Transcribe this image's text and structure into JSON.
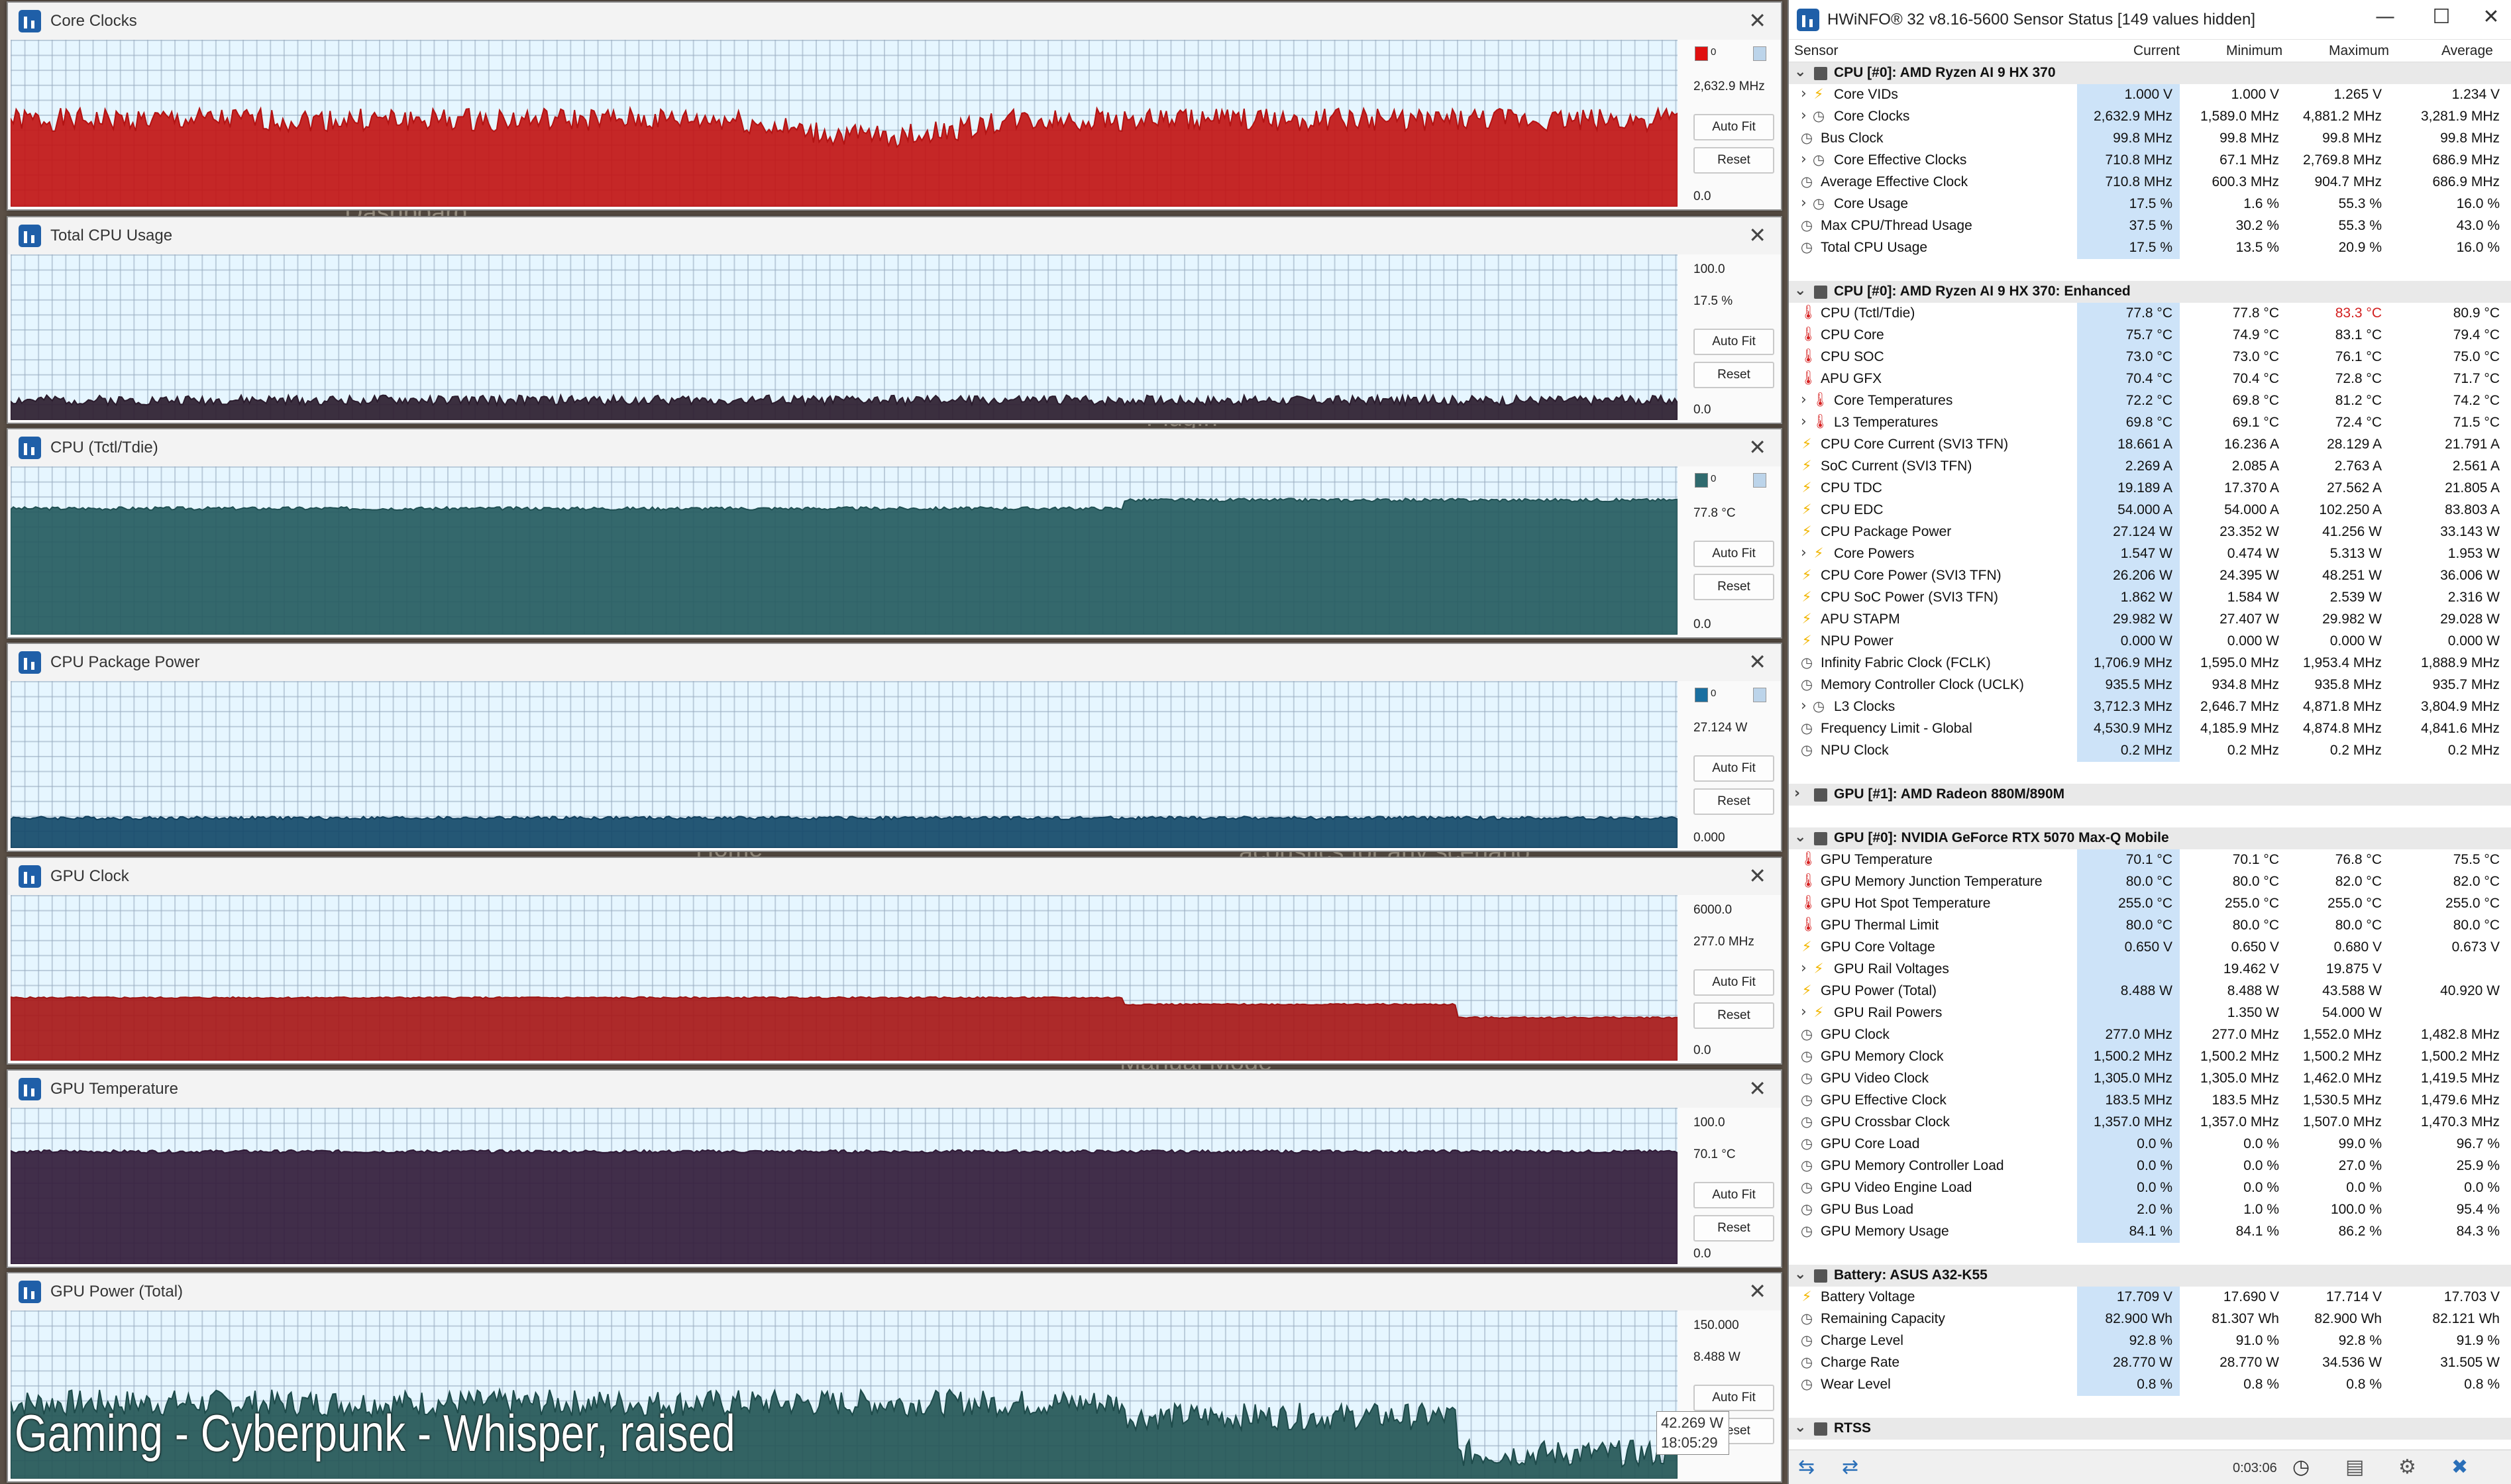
{
  "background": {
    "texts": [
      "Dashboard",
      "PlugIn",
      "Color Control",
      "Home",
      "acoustics for any scenario",
      "Manual Mode"
    ]
  },
  "graphs": [
    {
      "title": "Core Clocks",
      "value": "2,632.9 MHz",
      "max": "",
      "min": "0.0",
      "color": "#b31212",
      "fill": "#c21515",
      "swatch": "#e01010",
      "swatch_text": "0",
      "level": 0.52,
      "noise": 0.07,
      "seed": 1,
      "autofit": "Auto Fit",
      "reset": "Reset"
    },
    {
      "title": "Total CPU Usage",
      "value": "17.5 %",
      "max": "100.0",
      "min": "0.0",
      "color": "#2a1b2c",
      "fill": "#2d1d2f",
      "swatch": "",
      "swatch_text": "",
      "level": 0.12,
      "noise": 0.03,
      "seed": 2,
      "autofit": "Auto Fit",
      "reset": "Reset"
    },
    {
      "title": "CPU (Tctl/Tdie)",
      "value": "77.8 °C",
      "max": "",
      "min": "0.0",
      "color": "#1f4f52",
      "fill": "#255b5f",
      "swatch": "#2f6a6e",
      "swatch_text": "0",
      "level": 0.75,
      "noise": 0.01,
      "seed": 3,
      "autofit": "Auto Fit",
      "reset": "Reset"
    },
    {
      "title": "CPU Package Power",
      "value": "27.124 W",
      "max": "",
      "min": "0.000",
      "color": "#113f5c",
      "fill": "#134969",
      "swatch": "#1a6fa0",
      "swatch_text": "0",
      "level": 0.18,
      "noise": 0.01,
      "seed": 4,
      "autofit": "Auto Fit",
      "reset": "Reset"
    },
    {
      "title": "GPU Clock",
      "value": "277.0 MHz",
      "max": "6000.0",
      "min": "0.0",
      "color": "#9c1515",
      "fill": "#a81818",
      "swatch": "",
      "swatch_text": "",
      "level": 0.38,
      "noise": 0.005,
      "seed": 5,
      "autofit": "Auto Fit",
      "reset": "Reset"
    },
    {
      "title": "GPU Temperature",
      "value": "70.1 °C",
      "max": "100.0",
      "min": "0.0",
      "color": "#2e1935",
      "fill": "#331c3b",
      "swatch": "",
      "swatch_text": "",
      "level": 0.72,
      "noise": 0.01,
      "seed": 6,
      "autofit": "Auto Fit",
      "reset": "Reset"
    },
    {
      "title": "GPU Power (Total)",
      "value": "8.488 W",
      "max": "150.000",
      "min": "",
      "color": "#1d4a4a",
      "fill": "#245656",
      "swatch": "",
      "swatch_text": "",
      "level": 0.45,
      "noise": 0.08,
      "seed": 7,
      "autofit": "Auto Fit",
      "reset": "Reset"
    }
  ],
  "overlay": {
    "text": "Gaming - Cyberpunk - Whisper, raised"
  },
  "tooltip": {
    "value": "42.269 W",
    "time": "18:05:29"
  },
  "hwinfo": {
    "title": "HWiNFO® 32 v8.16-5600 Sensor Status [149 values hidden]",
    "minimize": "—",
    "maximize": "☐",
    "close": "✕",
    "columns": {
      "sensor": "Sensor",
      "current": "Current",
      "minimum": "Minimum",
      "maximum": "Maximum",
      "average": "Average"
    },
    "rows": [
      {
        "type": "group",
        "name": "CPU [#0]: AMD Ryzen AI 9 HX 370"
      },
      {
        "type": "row",
        "icon": "volt",
        "exp": true,
        "name": "Core VIDs",
        "cur": "1.000 V",
        "min": "1.000 V",
        "max": "1.265 V",
        "avg": "1.234 V"
      },
      {
        "type": "row",
        "icon": "clock",
        "exp": true,
        "name": "Core Clocks",
        "cur": "2,632.9 MHz",
        "min": "1,589.0 MHz",
        "max": "4,881.2 MHz",
        "avg": "3,281.9 MHz"
      },
      {
        "type": "row",
        "icon": "clock",
        "name": "Bus Clock",
        "cur": "99.8 MHz",
        "min": "99.8 MHz",
        "max": "99.8 MHz",
        "avg": "99.8 MHz"
      },
      {
        "type": "row",
        "icon": "clock",
        "exp": true,
        "name": "Core Effective Clocks",
        "cur": "710.8 MHz",
        "min": "67.1 MHz",
        "max": "2,769.8 MHz",
        "avg": "686.9 MHz"
      },
      {
        "type": "row",
        "icon": "clock",
        "name": "Average Effective Clock",
        "cur": "710.8 MHz",
        "min": "600.3 MHz",
        "max": "904.7 MHz",
        "avg": "686.9 MHz"
      },
      {
        "type": "row",
        "icon": "clock",
        "exp": true,
        "name": "Core Usage",
        "cur": "17.5 %",
        "min": "1.6 %",
        "max": "55.3 %",
        "avg": "16.0 %"
      },
      {
        "type": "row",
        "icon": "clock",
        "name": "Max CPU/Thread Usage",
        "cur": "37.5 %",
        "min": "30.2 %",
        "max": "55.3 %",
        "avg": "43.0 %"
      },
      {
        "type": "row",
        "icon": "clock",
        "name": "Total CPU Usage",
        "cur": "17.5 %",
        "min": "13.5 %",
        "max": "20.9 %",
        "avg": "16.0 %"
      },
      {
        "type": "spacer"
      },
      {
        "type": "group",
        "name": "CPU [#0]: AMD Ryzen AI 9 HX 370: Enhanced"
      },
      {
        "type": "row",
        "icon": "temp",
        "name": "CPU (Tctl/Tdie)",
        "cur": "77.8 °C",
        "min": "77.8 °C",
        "max": "83.3 °C",
        "max_red": true,
        "avg": "80.9 °C"
      },
      {
        "type": "row",
        "icon": "temp",
        "name": "CPU Core",
        "cur": "75.7 °C",
        "min": "74.9 °C",
        "max": "83.1 °C",
        "avg": "79.4 °C"
      },
      {
        "type": "row",
        "icon": "temp",
        "name": "CPU SOC",
        "cur": "73.0 °C",
        "min": "73.0 °C",
        "max": "76.1 °C",
        "avg": "75.0 °C"
      },
      {
        "type": "row",
        "icon": "temp",
        "name": "APU GFX",
        "cur": "70.4 °C",
        "min": "70.4 °C",
        "max": "72.8 °C",
        "avg": "71.7 °C"
      },
      {
        "type": "row",
        "icon": "temp",
        "exp": true,
        "name": "Core Temperatures",
        "cur": "72.2 °C",
        "min": "69.8 °C",
        "max": "81.2 °C",
        "avg": "74.2 °C"
      },
      {
        "type": "row",
        "icon": "temp",
        "exp": true,
        "name": "L3 Temperatures",
        "cur": "69.8 °C",
        "min": "69.1 °C",
        "max": "72.4 °C",
        "avg": "71.5 °C"
      },
      {
        "type": "row",
        "icon": "volt",
        "name": "CPU Core Current (SVI3 TFN)",
        "cur": "18.661 A",
        "min": "16.236 A",
        "max": "28.129 A",
        "avg": "21.791 A"
      },
      {
        "type": "row",
        "icon": "volt",
        "name": "SoC Current (SVI3 TFN)",
        "cur": "2.269 A",
        "min": "2.085 A",
        "max": "2.763 A",
        "avg": "2.561 A"
      },
      {
        "type": "row",
        "icon": "volt",
        "name": "CPU TDC",
        "cur": "19.189 A",
        "min": "17.370 A",
        "max": "27.562 A",
        "avg": "21.805 A"
      },
      {
        "type": "row",
        "icon": "volt",
        "name": "CPU EDC",
        "cur": "54.000 A",
        "min": "54.000 A",
        "max": "102.250 A",
        "avg": "83.803 A"
      },
      {
        "type": "row",
        "icon": "volt",
        "name": "CPU Package Power",
        "cur": "27.124 W",
        "min": "23.352 W",
        "max": "41.256 W",
        "avg": "33.143 W"
      },
      {
        "type": "row",
        "icon": "volt",
        "exp": true,
        "name": "Core Powers",
        "cur": "1.547 W",
        "min": "0.474 W",
        "max": "5.313 W",
        "avg": "1.953 W"
      },
      {
        "type": "row",
        "icon": "volt",
        "name": "CPU Core Power (SVI3 TFN)",
        "cur": "26.206 W",
        "min": "24.395 W",
        "max": "48.251 W",
        "avg": "36.006 W"
      },
      {
        "type": "row",
        "icon": "volt",
        "name": "CPU SoC Power (SVI3 TFN)",
        "cur": "1.862 W",
        "min": "1.584 W",
        "max": "2.539 W",
        "avg": "2.316 W"
      },
      {
        "type": "row",
        "icon": "volt",
        "name": "APU STAPM",
        "cur": "29.982 W",
        "min": "27.407 W",
        "max": "29.982 W",
        "avg": "29.028 W"
      },
      {
        "type": "row",
        "icon": "volt",
        "name": "NPU Power",
        "cur": "0.000 W",
        "min": "0.000 W",
        "max": "0.000 W",
        "avg": "0.000 W"
      },
      {
        "type": "row",
        "icon": "clock",
        "name": "Infinity Fabric Clock (FCLK)",
        "cur": "1,706.9 MHz",
        "min": "1,595.0 MHz",
        "max": "1,953.4 MHz",
        "avg": "1,888.9 MHz"
      },
      {
        "type": "row",
        "icon": "clock",
        "name": "Memory Controller Clock (UCLK)",
        "cur": "935.5 MHz",
        "min": "934.8 MHz",
        "max": "935.8 MHz",
        "avg": "935.7 MHz"
      },
      {
        "type": "row",
        "icon": "clock",
        "exp": true,
        "name": "L3 Clocks",
        "cur": "3,712.3 MHz",
        "min": "2,646.7 MHz",
        "max": "4,871.8 MHz",
        "avg": "3,804.9 MHz"
      },
      {
        "type": "row",
        "icon": "clock",
        "name": "Frequency Limit - Global",
        "cur": "4,530.9 MHz",
        "min": "4,185.9 MHz",
        "max": "4,874.8 MHz",
        "avg": "4,841.6 MHz"
      },
      {
        "type": "row",
        "icon": "clock",
        "name": "NPU Clock",
        "cur": "0.2 MHz",
        "min": "0.2 MHz",
        "max": "0.2 MHz",
        "avg": "0.2 MHz"
      },
      {
        "type": "spacer"
      },
      {
        "type": "group",
        "collapsed": true,
        "name": "GPU [#1]: AMD Radeon 880M/890M"
      },
      {
        "type": "spacer"
      },
      {
        "type": "group",
        "name": "GPU [#0]: NVIDIA  GeForce RTX 5070 Max-Q Mobile"
      },
      {
        "type": "row",
        "icon": "temp",
        "name": "GPU Temperature",
        "cur": "70.1 °C",
        "min": "70.1 °C",
        "max": "76.8 °C",
        "avg": "75.5 °C"
      },
      {
        "type": "row",
        "icon": "temp",
        "name": "GPU Memory Junction Temperature",
        "cur": "80.0 °C",
        "min": "80.0 °C",
        "max": "82.0 °C",
        "avg": "82.0 °C"
      },
      {
        "type": "row",
        "icon": "temp",
        "name": "GPU Hot Spot Temperature",
        "cur": "255.0 °C",
        "min": "255.0 °C",
        "max": "255.0 °C",
        "avg": "255.0 °C"
      },
      {
        "type": "row",
        "icon": "temp",
        "name": "GPU Thermal Limit",
        "cur": "80.0 °C",
        "min": "80.0 °C",
        "max": "80.0 °C",
        "avg": "80.0 °C"
      },
      {
        "type": "row",
        "icon": "volt",
        "name": "GPU Core Voltage",
        "cur": "0.650 V",
        "min": "0.650 V",
        "max": "0.680 V",
        "avg": "0.673 V"
      },
      {
        "type": "row",
        "icon": "volt",
        "exp": true,
        "name": "GPU Rail Voltages",
        "cur": "",
        "min": "19.462 V",
        "max": "19.875 V",
        "avg": ""
      },
      {
        "type": "row",
        "icon": "volt",
        "name": "GPU Power (Total)",
        "cur": "8.488 W",
        "min": "8.488 W",
        "max": "43.588 W",
        "avg": "40.920 W"
      },
      {
        "type": "row",
        "icon": "volt",
        "exp": true,
        "name": "GPU Rail Powers",
        "cur": "",
        "min": "1.350 W",
        "max": "54.000 W",
        "avg": ""
      },
      {
        "type": "row",
        "icon": "clock",
        "name": "GPU Clock",
        "cur": "277.0 MHz",
        "min": "277.0 MHz",
        "max": "1,552.0 MHz",
        "avg": "1,482.8 MHz"
      },
      {
        "type": "row",
        "icon": "clock",
        "name": "GPU Memory Clock",
        "cur": "1,500.2 MHz",
        "min": "1,500.2 MHz",
        "max": "1,500.2 MHz",
        "avg": "1,500.2 MHz"
      },
      {
        "type": "row",
        "icon": "clock",
        "name": "GPU Video Clock",
        "cur": "1,305.0 MHz",
        "min": "1,305.0 MHz",
        "max": "1,462.0 MHz",
        "avg": "1,419.5 MHz"
      },
      {
        "type": "row",
        "icon": "clock",
        "name": "GPU Effective Clock",
        "cur": "183.5 MHz",
        "min": "183.5 MHz",
        "max": "1,530.5 MHz",
        "avg": "1,479.6 MHz"
      },
      {
        "type": "row",
        "icon": "clock",
        "name": "GPU Crossbar Clock",
        "cur": "1,357.0 MHz",
        "min": "1,357.0 MHz",
        "max": "1,507.0 MHz",
        "avg": "1,470.3 MHz"
      },
      {
        "type": "row",
        "icon": "clock",
        "name": "GPU Core Load",
        "cur": "0.0 %",
        "min": "0.0 %",
        "max": "99.0 %",
        "avg": "96.7 %"
      },
      {
        "type": "row",
        "icon": "clock",
        "name": "GPU Memory Controller Load",
        "cur": "0.0 %",
        "min": "0.0 %",
        "max": "27.0 %",
        "avg": "25.9 %"
      },
      {
        "type": "row",
        "icon": "clock",
        "name": "GPU Video Engine Load",
        "cur": "0.0 %",
        "min": "0.0 %",
        "max": "0.0 %",
        "avg": "0.0 %"
      },
      {
        "type": "row",
        "icon": "clock",
        "name": "GPU Bus Load",
        "cur": "2.0 %",
        "min": "1.0 %",
        "max": "100.0 %",
        "avg": "95.4 %"
      },
      {
        "type": "row",
        "icon": "clock",
        "name": "GPU Memory Usage",
        "cur": "84.1 %",
        "min": "84.1 %",
        "max": "86.2 %",
        "avg": "84.3 %"
      },
      {
        "type": "spacer"
      },
      {
        "type": "group",
        "name": "Battery: ASUS  A32-K55"
      },
      {
        "type": "row",
        "icon": "volt",
        "name": "Battery Voltage",
        "cur": "17.709 V",
        "min": "17.690 V",
        "max": "17.714 V",
        "avg": "17.703 V"
      },
      {
        "type": "row",
        "icon": "clock",
        "name": "Remaining Capacity",
        "cur": "82.900 Wh",
        "min": "81.307 Wh",
        "max": "82.900 Wh",
        "avg": "82.121 Wh"
      },
      {
        "type": "row",
        "icon": "clock",
        "name": "Charge Level",
        "cur": "92.8 %",
        "min": "91.0 %",
        "max": "92.8 %",
        "avg": "91.9 %"
      },
      {
        "type": "row",
        "icon": "clock",
        "name": "Charge Rate",
        "cur": "28.770 W",
        "min": "28.770 W",
        "max": "34.536 W",
        "avg": "31.505 W"
      },
      {
        "type": "row",
        "icon": "clock",
        "name": "Wear Level",
        "cur": "0.8 %",
        "min": "0.8 %",
        "max": "0.8 %",
        "avg": "0.8 %"
      },
      {
        "type": "spacer"
      },
      {
        "type": "group",
        "name": "RTSS"
      }
    ],
    "footer": {
      "time": "0:03:06"
    }
  }
}
